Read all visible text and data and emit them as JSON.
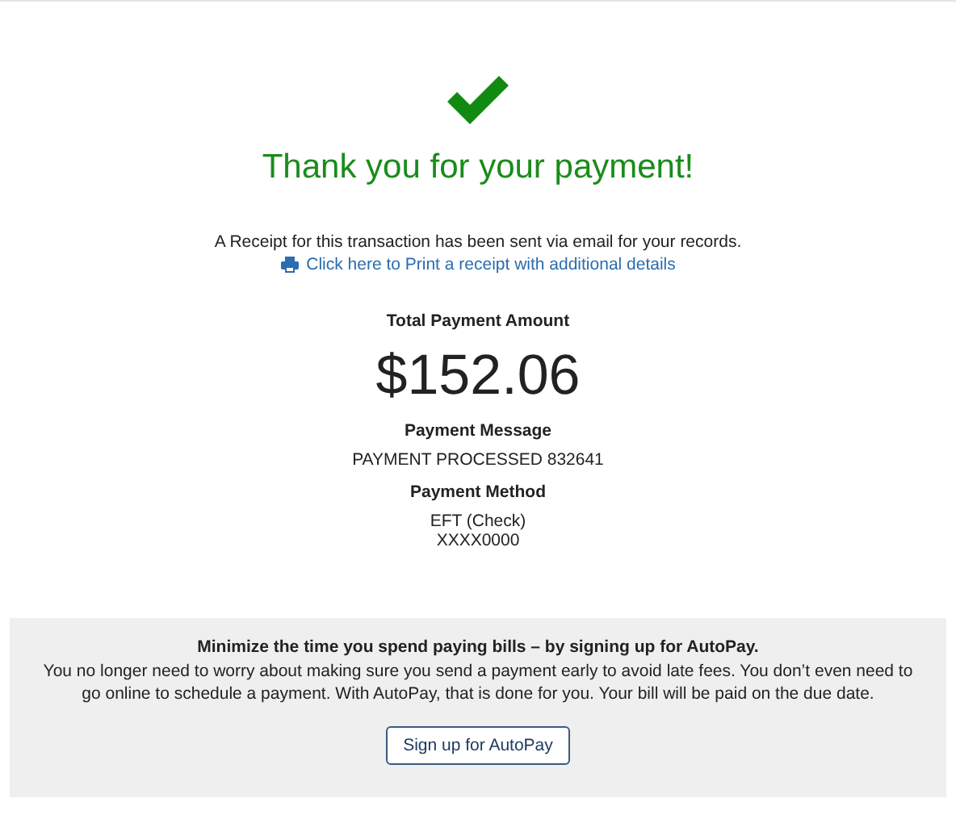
{
  "confirmation": {
    "title": "Thank you for your payment!",
    "receipt_note": "A Receipt for this transaction has been sent via email for your records.",
    "print_link": "Click here to Print a receipt with additional details"
  },
  "total": {
    "label": "Total Payment Amount",
    "amount": "$152.06"
  },
  "details": [
    {
      "label": "Payment Message",
      "lines": [
        "PAYMENT PROCESSED 832641"
      ]
    },
    {
      "label": "Payment Method",
      "lines": [
        "EFT (Check)",
        "XXXX0000"
      ]
    }
  ],
  "autopay": {
    "heading": "Minimize the time you spend paying bills – by signing up for AutoPay.",
    "text": "You no longer need to worry about making sure you send a payment early to avoid late fees. You don’t even need to go online to schedule a payment. With AutoPay, that is done for you. Your bill will be paid on the due date.",
    "button": "Sign up for AutoPay"
  }
}
